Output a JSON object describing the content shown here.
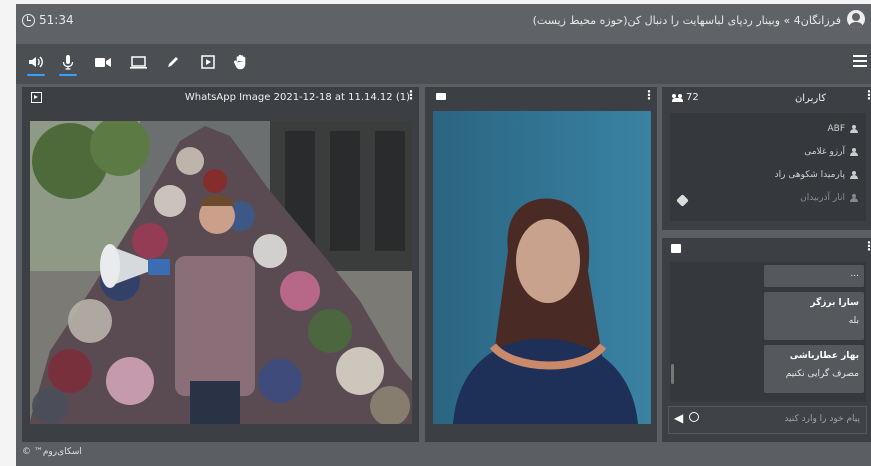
{
  "header": {
    "timer": "51:34",
    "title": "فرزانگان4 » وبینار ردپای لباسهایت را دنبال کن(حوزه محیط زیست)"
  },
  "toolbar": {
    "items": [
      "speaker-icon",
      "microphone-icon",
      "camera-icon",
      "screen-share-icon",
      "pen-icon",
      "presentation-icon",
      "raise-hand-icon",
      "menu-icon"
    ]
  },
  "share_panel": {
    "file_title": "WhatsApp Image 2021-12-18 at 11.14.12 (1)"
  },
  "users_panel": {
    "count": "72",
    "label": "کاربران",
    "users": [
      "ABF",
      "آرزو غلامی",
      "پارمیدا شکوهی راد",
      "انار آذربیدان"
    ]
  },
  "chat_panel": {
    "messages": [
      {
        "sender": "",
        "text": "..."
      },
      {
        "sender": "سارا برزگر",
        "text": "بله"
      },
      {
        "sender": "بهار عطارباشی",
        "text": "مصرف گرایی نکنیم"
      }
    ],
    "input_placeholder": "پیام خود را وارد کنید"
  },
  "footer": {
    "brand": "اسکای‌روم™ ©"
  }
}
